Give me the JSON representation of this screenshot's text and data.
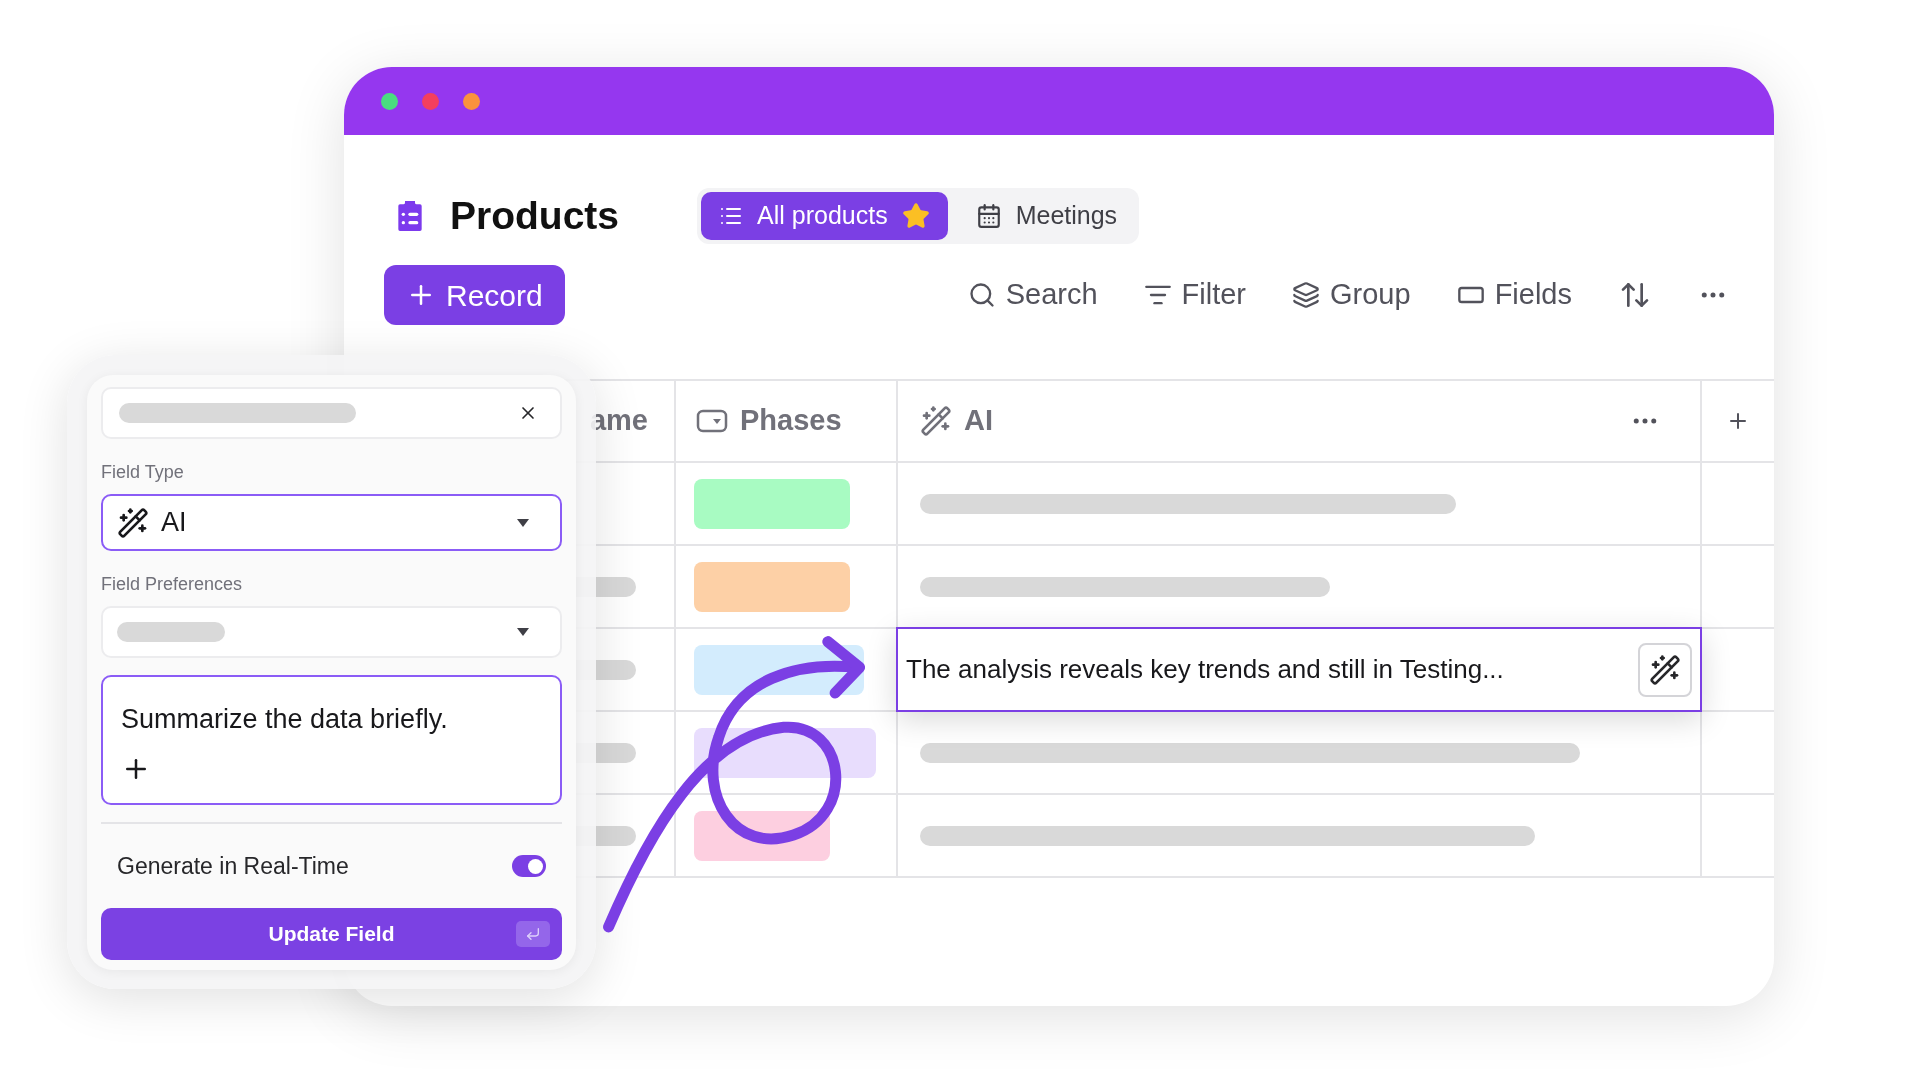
{
  "header": {
    "title": "Products",
    "views": [
      {
        "label": "All products",
        "selected": true,
        "starred": true
      },
      {
        "label": "Meetings",
        "selected": false,
        "starred": false
      }
    ]
  },
  "toolbar": {
    "add_button": "Record",
    "actions": [
      {
        "label": "Search"
      },
      {
        "label": "Filter"
      },
      {
        "label": "Group"
      },
      {
        "label": "Fields"
      }
    ]
  },
  "table": {
    "columns": [
      {
        "label": "ame"
      },
      {
        "label": "Phases"
      },
      {
        "label": "AI"
      }
    ],
    "rows": [
      {
        "color": "#a8fbc2",
        "selected": false
      },
      {
        "color": "#fdd0a6",
        "selected": false
      },
      {
        "color": "#d3ecfd",
        "selected": true,
        "ai_text": "The analysis reveals key trends and still in Testing..."
      },
      {
        "color": "#e8ddfd",
        "selected": false
      },
      {
        "color": "#fdcfe0",
        "selected": false
      }
    ]
  },
  "field_editor": {
    "field_type_label": "Field Type",
    "field_type_value": "AI",
    "preferences_label": "Field Preferences",
    "prompt": "Summarize the data briefly.",
    "realtime_label": "Generate in Real-Time",
    "realtime_on": true,
    "submit": "Update Field"
  }
}
